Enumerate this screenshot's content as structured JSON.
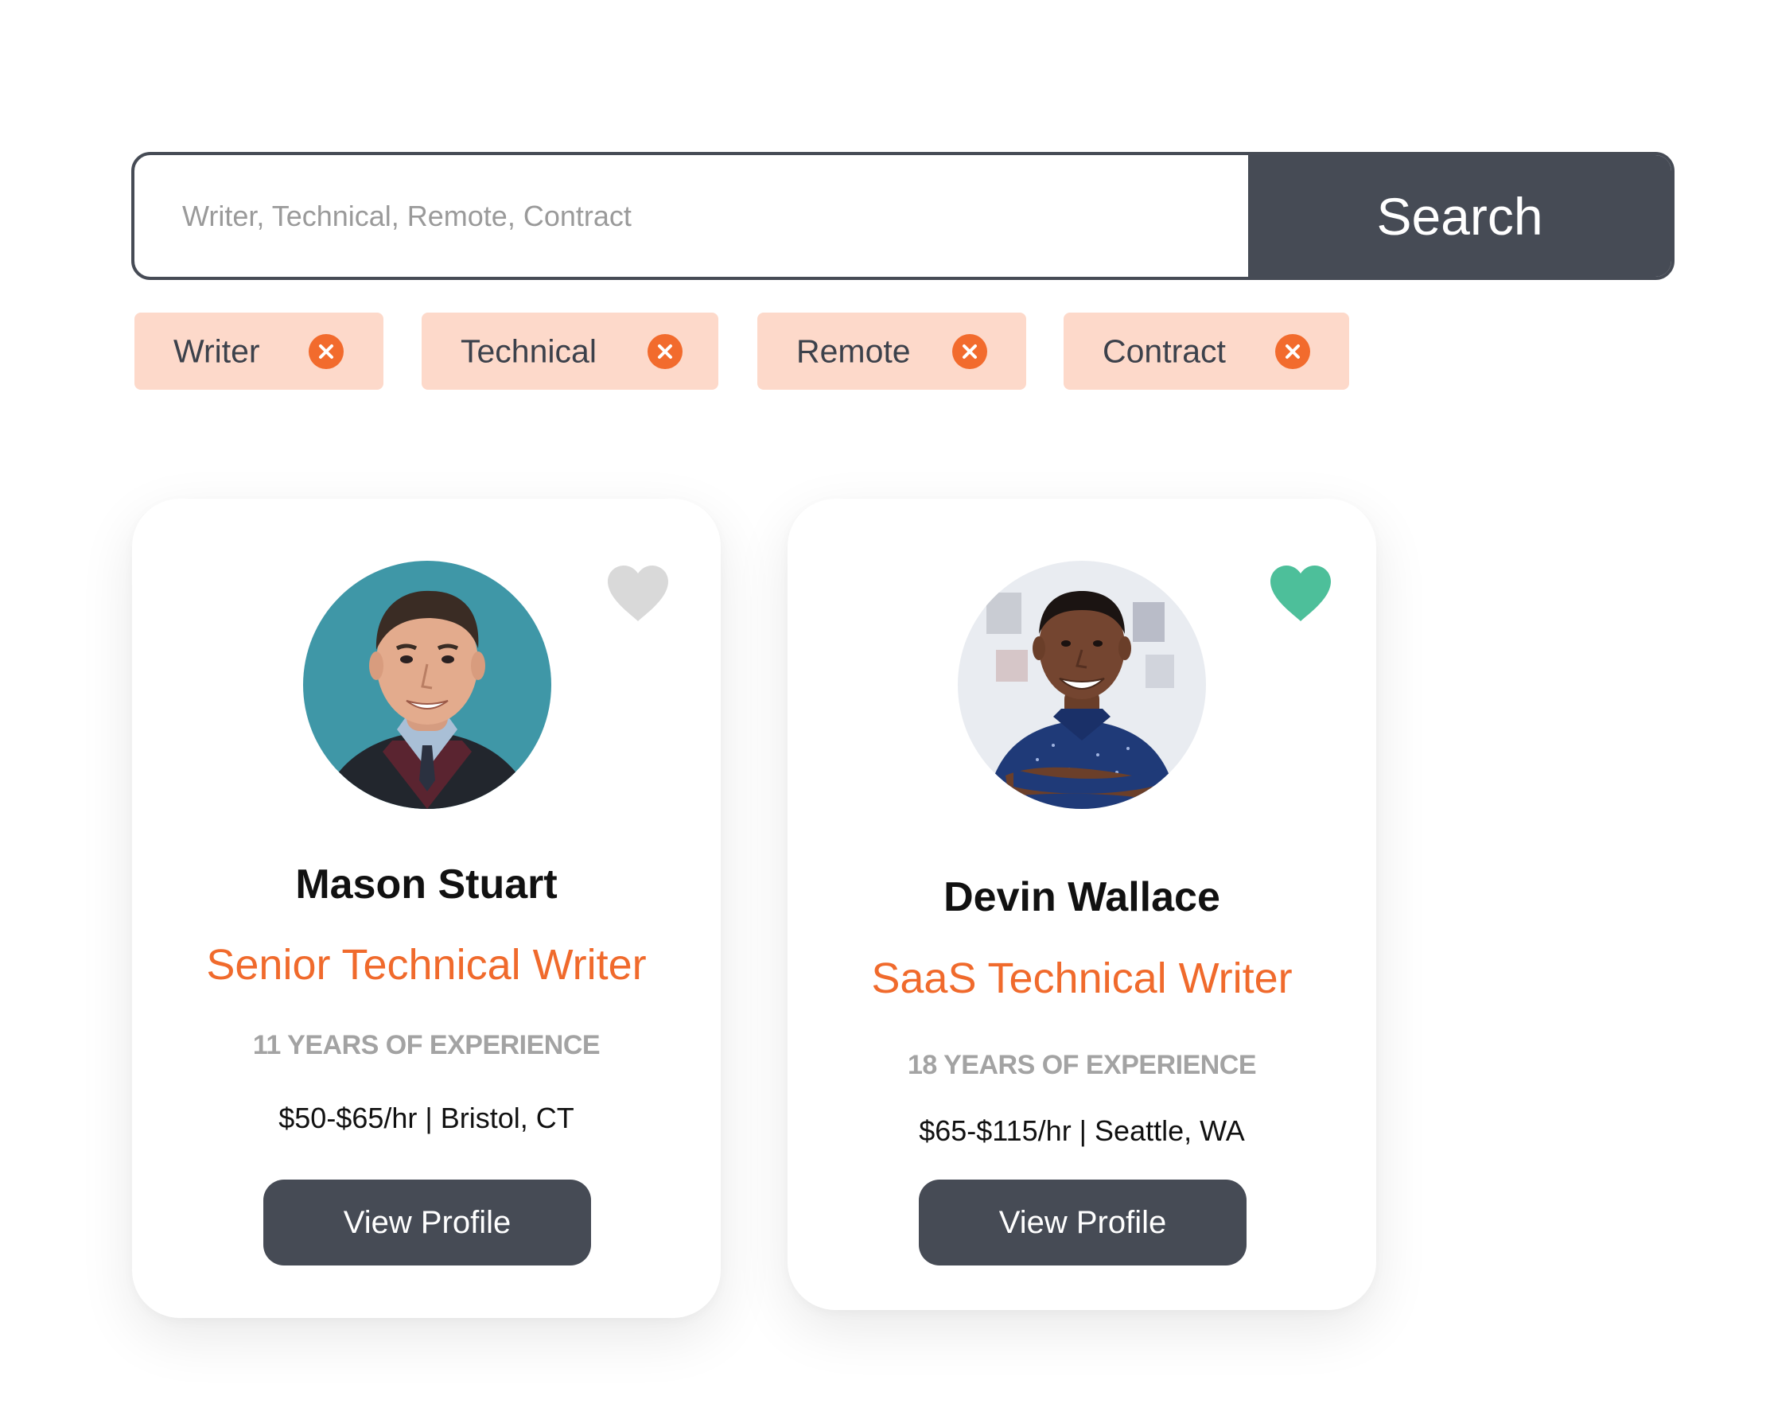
{
  "search": {
    "placeholder": "Writer, Technical, Remote, Contract",
    "button_label": "Search"
  },
  "filters": [
    {
      "label": "Writer",
      "remove_icon": "close-circle-icon"
    },
    {
      "label": "Technical",
      "remove_icon": "close-circle-icon"
    },
    {
      "label": "Remote",
      "remove_icon": "close-circle-icon"
    },
    {
      "label": "Contract",
      "remove_icon": "close-circle-icon"
    }
  ],
  "profiles": [
    {
      "name": "Mason Stuart",
      "title": "Senior Technical Writer",
      "experience": "11 YEARS OF EXPERIENCE",
      "rate_location": "$50-$65/hr | Bristol, CT",
      "button_label": "View Profile",
      "favorited": false,
      "favorite_icon": "heart-icon"
    },
    {
      "name": "Devin Wallace",
      "title": "SaaS Technical Writer",
      "experience": "18 YEARS OF EXPERIENCE",
      "rate_location": "$65-$115/hr | Seattle, WA",
      "button_label": "View Profile",
      "favorited": true,
      "favorite_icon": "heart-icon"
    }
  ],
  "colors": {
    "accent_orange": "#f06a2c",
    "chip_background": "#fdd9ca",
    "dark_button": "#464b55",
    "favorite_active": "#4dbf9a",
    "favorite_inactive": "#d9d9d9"
  }
}
